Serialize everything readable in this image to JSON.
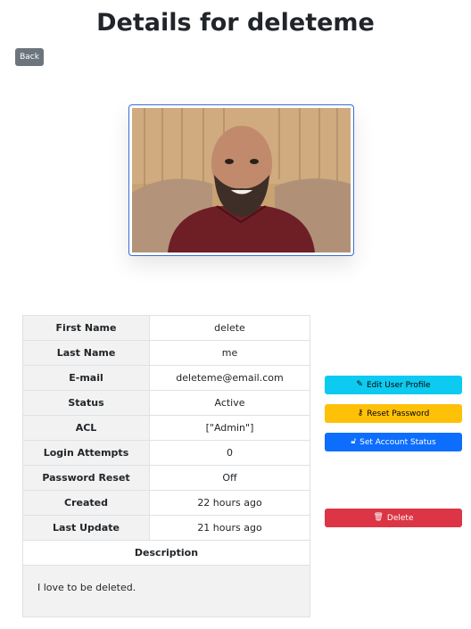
{
  "page": {
    "title": "Details for deleteme"
  },
  "nav": {
    "back_label": "Back"
  },
  "details": {
    "rows": [
      {
        "label": "First Name",
        "value": "delete"
      },
      {
        "label": "Last Name",
        "value": "me"
      },
      {
        "label": "E-mail",
        "value": "deleteme@email.com"
      },
      {
        "label": "Status",
        "value": "Active"
      },
      {
        "label": "ACL",
        "value": "[\"Admin\"]"
      },
      {
        "label": "Login Attempts",
        "value": "0"
      },
      {
        "label": "Password Reset",
        "value": "Off"
      },
      {
        "label": "Created",
        "value": "22 hours ago"
      },
      {
        "label": "Last Update",
        "value": "21 hours ago"
      }
    ],
    "description_label": "Description",
    "description": "I love to be deleted."
  },
  "actions": {
    "edit": {
      "label": "Edit User Profile",
      "icon": "edit-icon"
    },
    "reset": {
      "label": "Reset Password",
      "icon": "key-icon"
    },
    "status": {
      "label": "Set Account Status",
      "icon": "unlock-icon"
    },
    "delete": {
      "label": "Delete",
      "icon": "trash-icon"
    }
  },
  "colors": {
    "edit": "#0dcaf0",
    "reset": "#ffc107",
    "status": "#0d6efd",
    "delete": "#dc3545",
    "back": "#6c757d"
  }
}
